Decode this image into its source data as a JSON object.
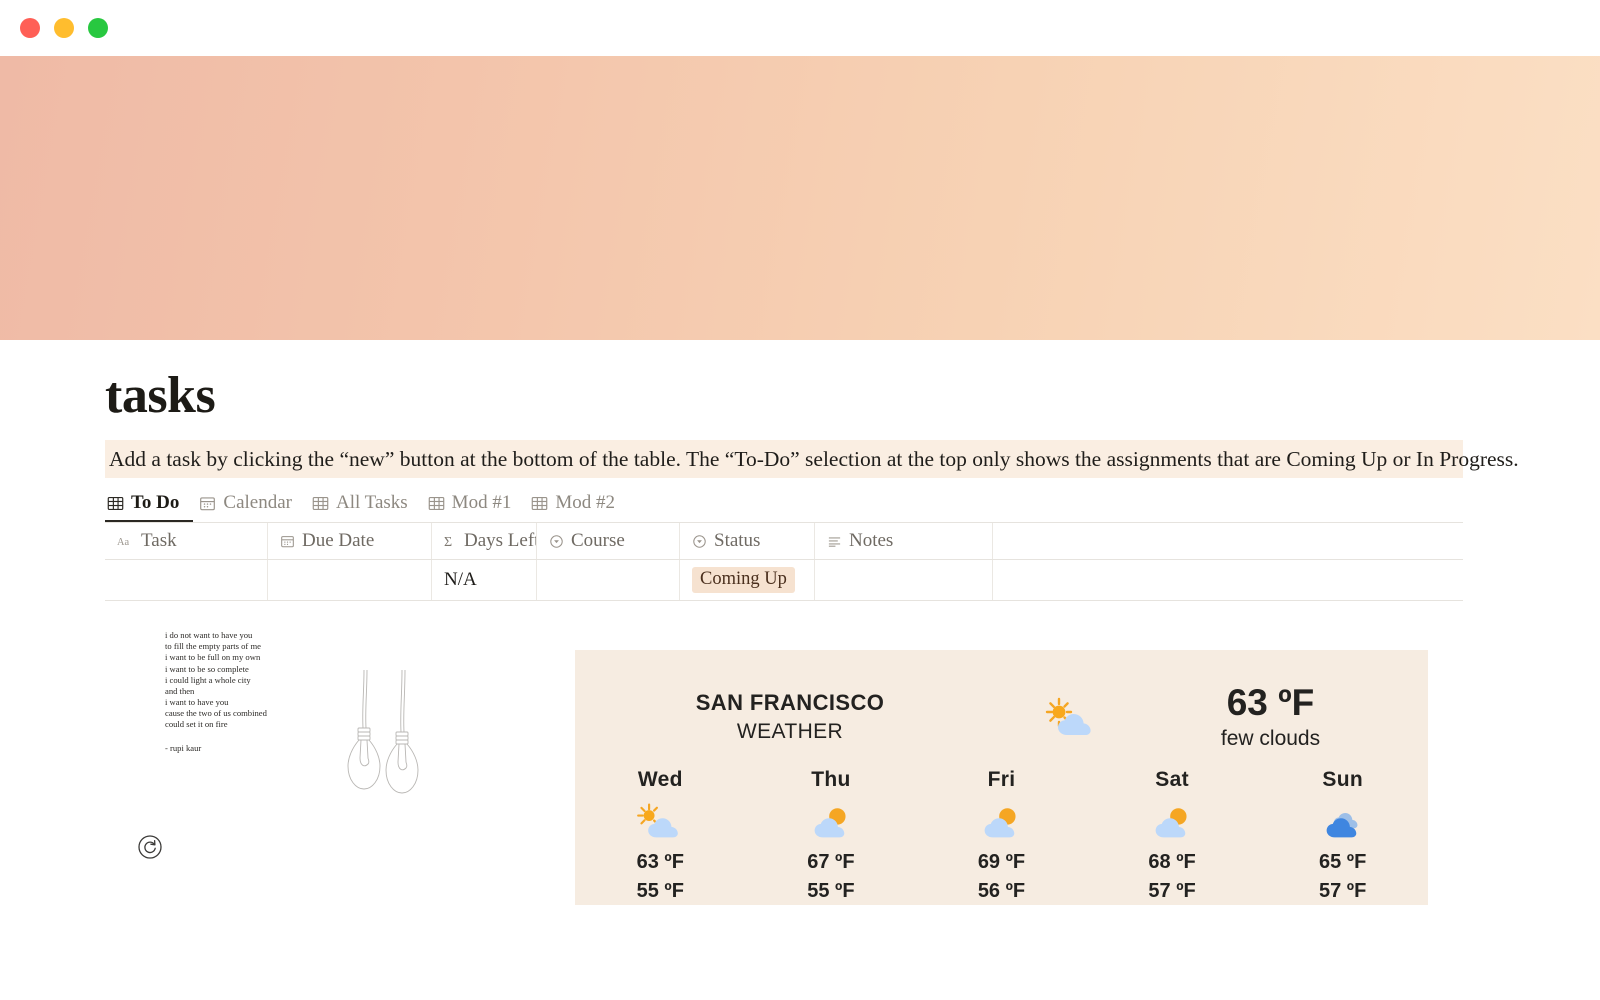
{
  "window": {
    "close_label": "close",
    "minimize_label": "minimize",
    "maximize_label": "maximize"
  },
  "page": {
    "title": "tasks",
    "callout": "Add a task by clicking the “new” button at the bottom of the table. The “To-Do” selection at the top only shows the assignments that are Coming Up or In Progress.",
    "cover_gradient_from": "#efbaa6",
    "cover_gradient_to": "#fbdfc4",
    "callout_bg": "#faeee2"
  },
  "tabs": [
    {
      "label": "To Do",
      "icon": "table-icon",
      "active": true
    },
    {
      "label": "Calendar",
      "icon": "calendar-icon",
      "active": false
    },
    {
      "label": "All Tasks",
      "icon": "table-icon",
      "active": false
    },
    {
      "label": "Mod #1",
      "icon": "table-icon",
      "active": false
    },
    {
      "label": "Mod #2",
      "icon": "table-icon",
      "active": false
    }
  ],
  "table": {
    "columns": [
      {
        "label": "Task",
        "icon": "text-type-icon"
      },
      {
        "label": "Due Date",
        "icon": "calendar-icon"
      },
      {
        "label": "Days Left",
        "icon": "formula-sigma-icon"
      },
      {
        "label": "Course",
        "icon": "select-icon"
      },
      {
        "label": "Status",
        "icon": "select-icon"
      },
      {
        "label": "Notes",
        "icon": "text-lines-icon"
      }
    ],
    "rows": [
      {
        "task": "",
        "due_date": "",
        "days_left": "N/A",
        "course": "",
        "status": "Coming Up",
        "status_bg": "#f6e2d0",
        "notes": ""
      }
    ]
  },
  "quote": {
    "lines": [
      "i do not want to have you",
      "to fill the empty parts of me",
      "i want to be full on my own",
      "i want to be so complete",
      "i could light a whole city",
      "and then",
      "i want to have you",
      "cause the two of us combined",
      "could set it on fire"
    ],
    "attribution": "- rupi kaur",
    "refresh_label": "refresh quote"
  },
  "weather": {
    "bg": "#f6ece1",
    "city": "SAN FRANCISCO",
    "subtitle": "WEATHER",
    "current_icon": "sun-behind-cloud-icon",
    "current_temp": "63 ºF",
    "current_desc": "few clouds",
    "forecast": [
      {
        "day": "Wed",
        "icon": "sun-behind-cloud-icon",
        "high": "63 ºF",
        "low": "55 ºF"
      },
      {
        "day": "Thu",
        "icon": "cloud-with-sun-icon",
        "high": "67 ºF",
        "low": "55 ºF"
      },
      {
        "day": "Fri",
        "icon": "cloud-with-sun-icon",
        "high": "69 ºF",
        "low": "56 ºF"
      },
      {
        "day": "Sat",
        "icon": "cloud-with-sun-icon",
        "high": "68 ºF",
        "low": "57 ºF"
      },
      {
        "day": "Sun",
        "icon": "broken-clouds-icon",
        "high": "65 ºF",
        "low": "57 ºF"
      }
    ]
  }
}
